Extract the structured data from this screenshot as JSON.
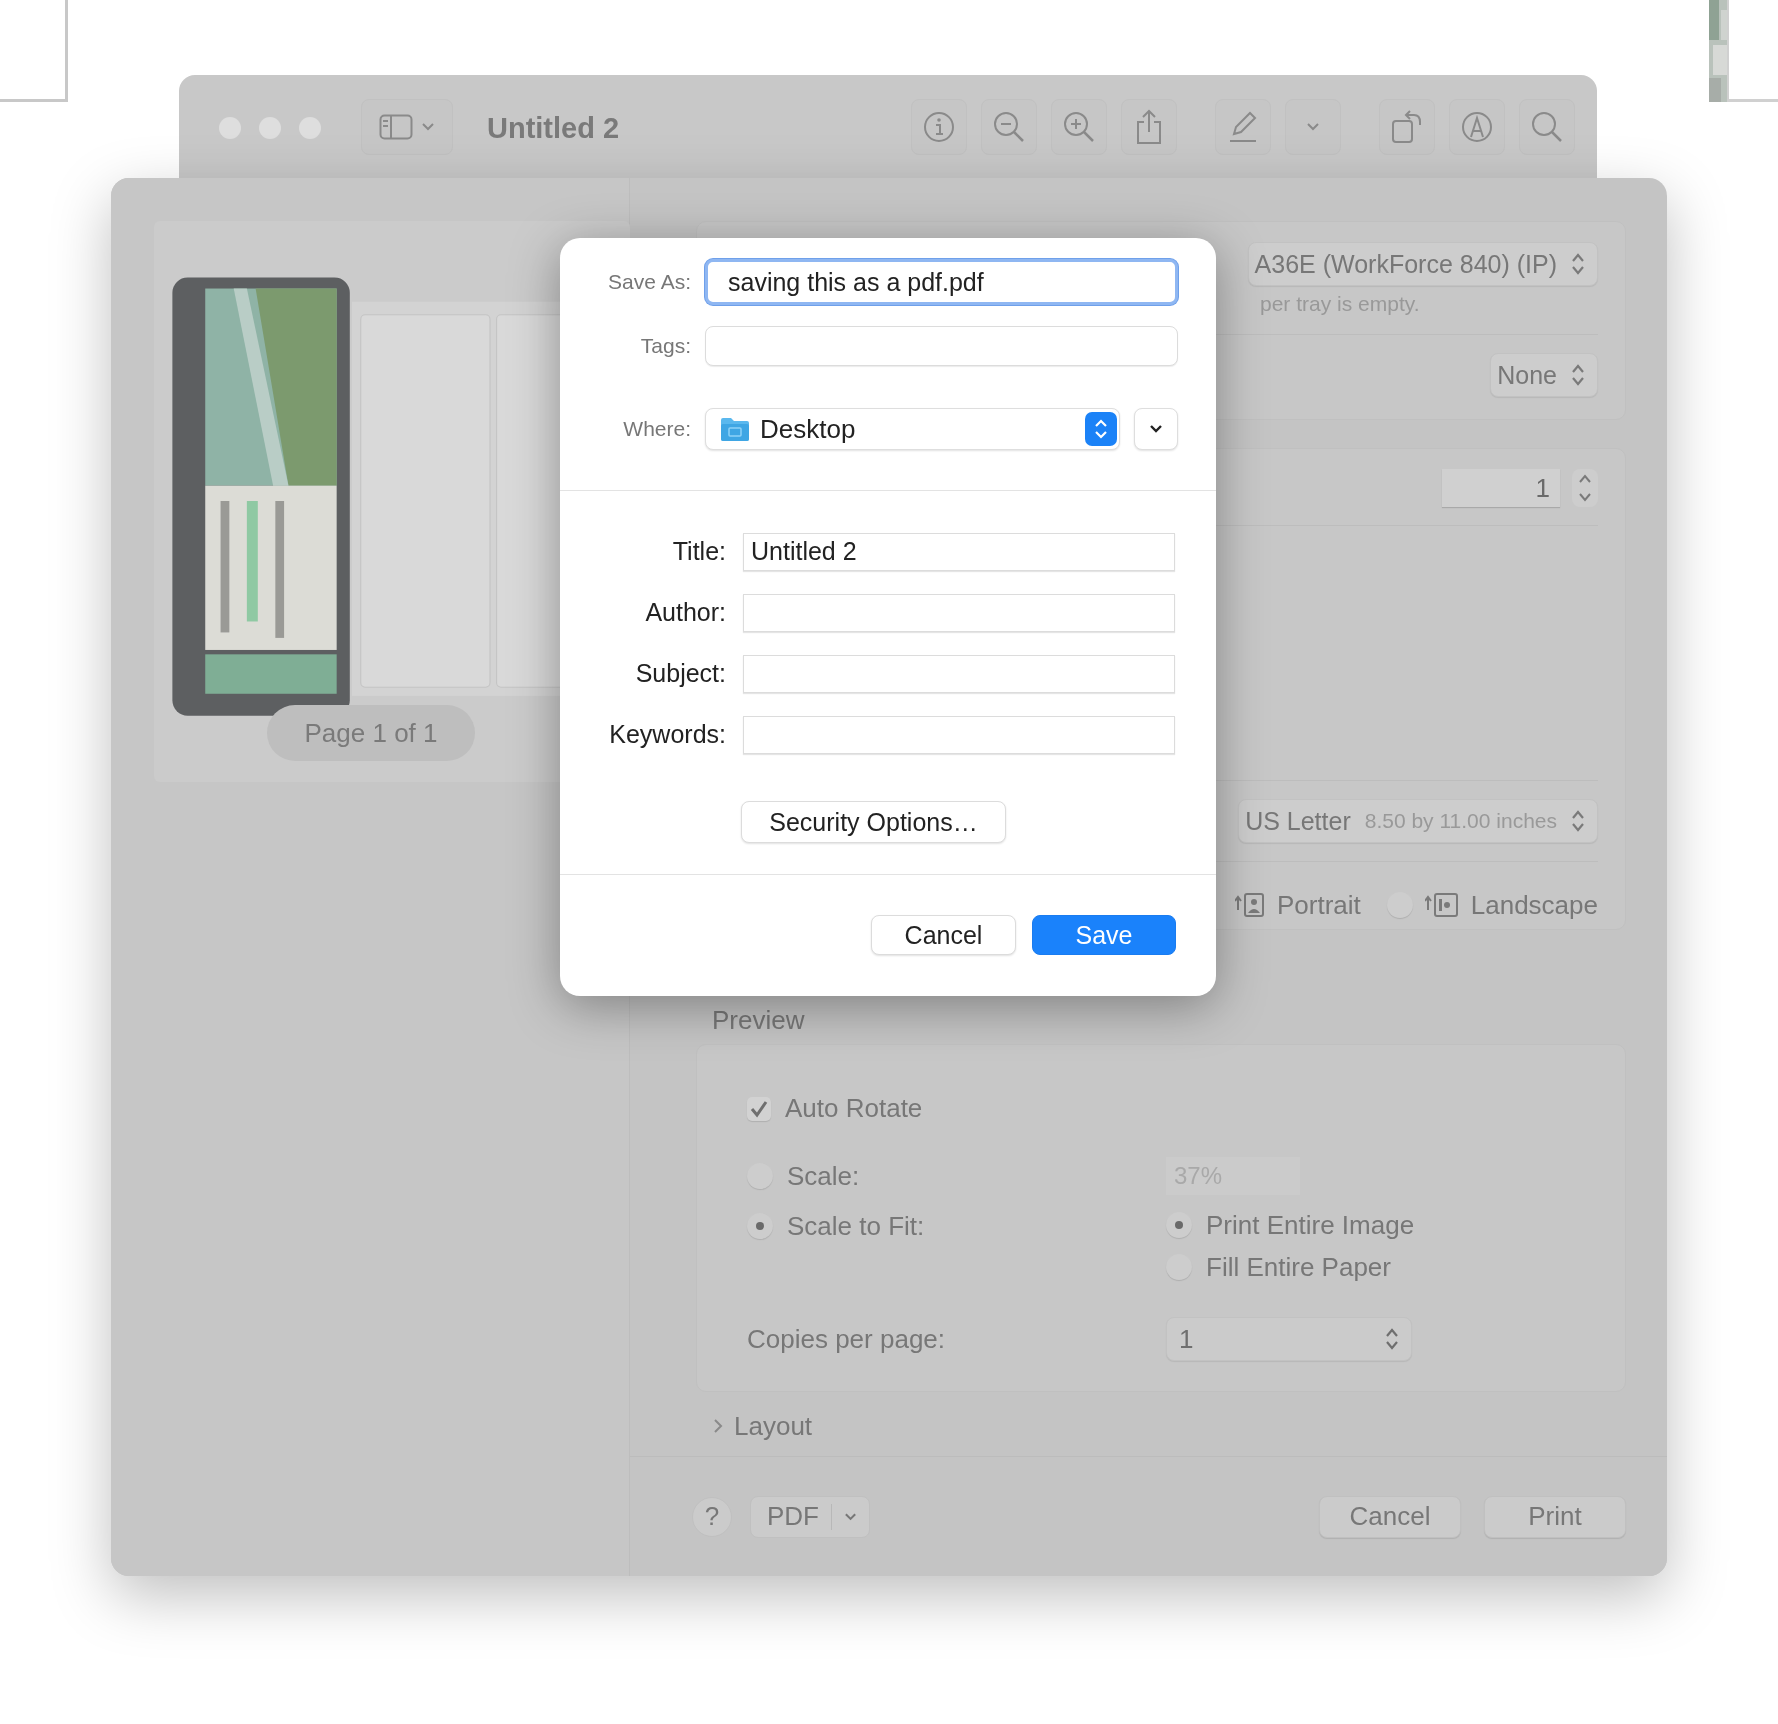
{
  "preview_window": {
    "title": "Untitled 2"
  },
  "print_sheet": {
    "page_label": "Page 1 of 1",
    "printer": {
      "value": "A36E (WorkForce 840) (IP)",
      "status": "per tray is empty."
    },
    "presets": {
      "value": "None"
    },
    "copies": {
      "value": "1"
    },
    "paper_size": {
      "value": "US Letter",
      "detail": "8.50 by 11.00 inches"
    },
    "orientation": {
      "portrait_label": "Portrait",
      "landscape": {
        "label": "Landscape",
        "selected": false
      }
    },
    "preview_section": {
      "heading": "Preview",
      "auto_rotate": {
        "label": "Auto Rotate",
        "checked": true
      },
      "scale": {
        "label": "Scale:",
        "selected": false,
        "value": "37%"
      },
      "scale_to_fit": {
        "label": "Scale to Fit:",
        "selected": true
      },
      "fit_options": [
        {
          "label": "Print Entire Image",
          "selected": true
        },
        {
          "label": "Fill Entire Paper",
          "selected": false
        }
      ],
      "copies_per_page": {
        "label": "Copies per page:",
        "value": "1"
      }
    },
    "layout_section": {
      "heading": "Layout",
      "expanded": false
    },
    "footer": {
      "help": "?",
      "pdf": "PDF",
      "buttons": [
        "Cancel",
        "Print"
      ]
    }
  },
  "save_dialog": {
    "save_as": {
      "label": "Save As:",
      "value": "saving this as a pdf.pdf"
    },
    "tags": {
      "label": "Tags:"
    },
    "where": {
      "label": "Where:",
      "value": "Desktop"
    },
    "metadata": [
      {
        "label": "Title:",
        "value": "Untitled 2"
      },
      {
        "label": "Author:"
      },
      {
        "label": "Subject:"
      },
      {
        "label": "Keywords:"
      }
    ],
    "security_button": "Security Options…",
    "buttons": [
      {
        "label": "Cancel",
        "kind": "secondary"
      },
      {
        "label": "Save",
        "kind": "primary"
      }
    ]
  }
}
